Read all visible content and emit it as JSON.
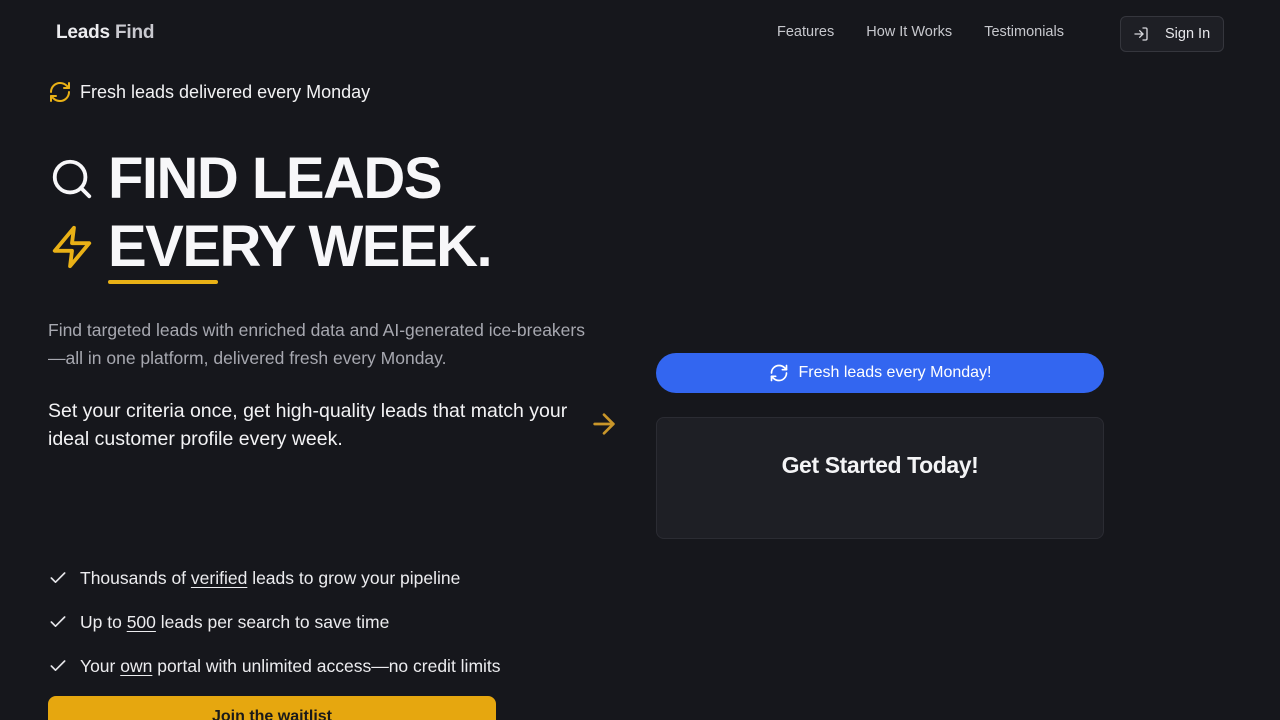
{
  "header": {
    "logo_part1": "Leads",
    "logo_part2": "Find",
    "nav": [
      "Features",
      "How It Works",
      "Testimonials"
    ],
    "signin_label": "Sign In"
  },
  "badge": {
    "text": "Fresh leads delivered every Monday",
    "icon": "refresh-icon"
  },
  "headline": {
    "line1": "FIND LEADS",
    "line2": "EVERY WEEK.",
    "line1_icon": "search-icon",
    "line2_icon": "lightning-icon"
  },
  "description": "Find targeted leads with enriched data and AI-generated ice-breakers—all in one platform, delivered fresh every Monday.",
  "subtext": "Set your criteria once, get high-quality leads that match your ideal customer profile every week.",
  "features": [
    {
      "before": "Thousands of ",
      "highlight": "verified",
      "after": " leads to grow your pipeline"
    },
    {
      "before": "Up to ",
      "highlight": "500",
      "after": " leads per search to save time"
    },
    {
      "before": "Your ",
      "highlight": "own",
      "after": " portal with unlimited access—no credit limits"
    }
  ],
  "cta_label": "Join the waitlist",
  "pill_label": "Fresh leads every Monday!",
  "card_title": "Get Started Today!",
  "colors": {
    "background": "#16171c",
    "accent_yellow": "#e9b116",
    "accent_blue": "#3366f0"
  }
}
